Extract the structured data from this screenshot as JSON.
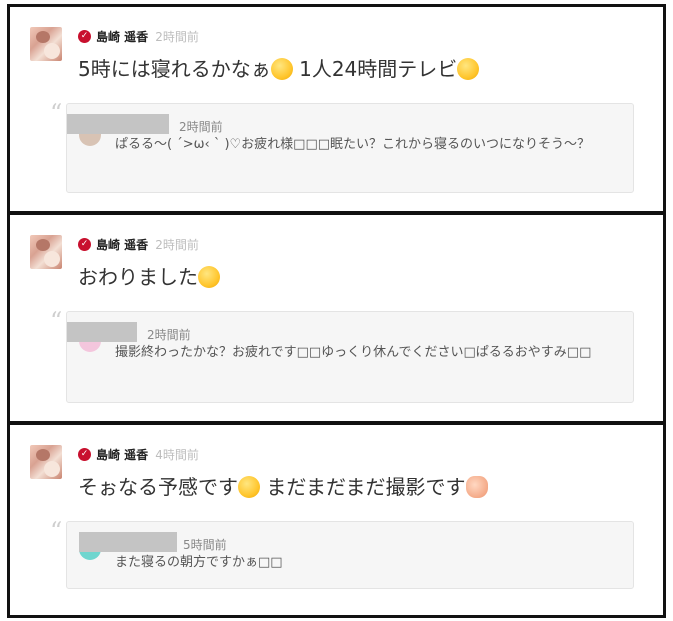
{
  "posts": [
    {
      "author": "島崎 遥香",
      "time": "2時間前",
      "message_before": "5時には寝れるかなぁ",
      "message_after": " 1人24時間テレビ",
      "emoji": [
        "sleepy-face-icon",
        "laughing-face-icon"
      ],
      "reply": {
        "time": "2時間前",
        "text": "ぱるる〜( ´>ω‹ ` )♡お疲れ様□□□眠たい？これから寝るのいつになりそう〜？"
      }
    },
    {
      "author": "島崎 遥香",
      "time": "2時間前",
      "message_before": "おわりました",
      "emoji": [
        "sleepy-face-icon"
      ],
      "reply": {
        "time": "2時間前",
        "text": "撮影終わったかな？お疲れです□□ゆっくり休んでください□ぱるるおやすみ□□"
      }
    },
    {
      "author": "島崎 遥香",
      "time": "4時間前",
      "message_before": "そぉなる予感です",
      "message_after": " まだまだまだ撮影です",
      "emoji": [
        "sleepy-face-icon",
        "flexed-biceps-icon"
      ],
      "reply": {
        "time": "5時間前",
        "text": "また寝るの朝方ですかぁ□□"
      }
    }
  ],
  "colors": {
    "badge": "#c8102e",
    "reply_bg": "#f6f6f6",
    "redaction": "#c4c4c4"
  }
}
